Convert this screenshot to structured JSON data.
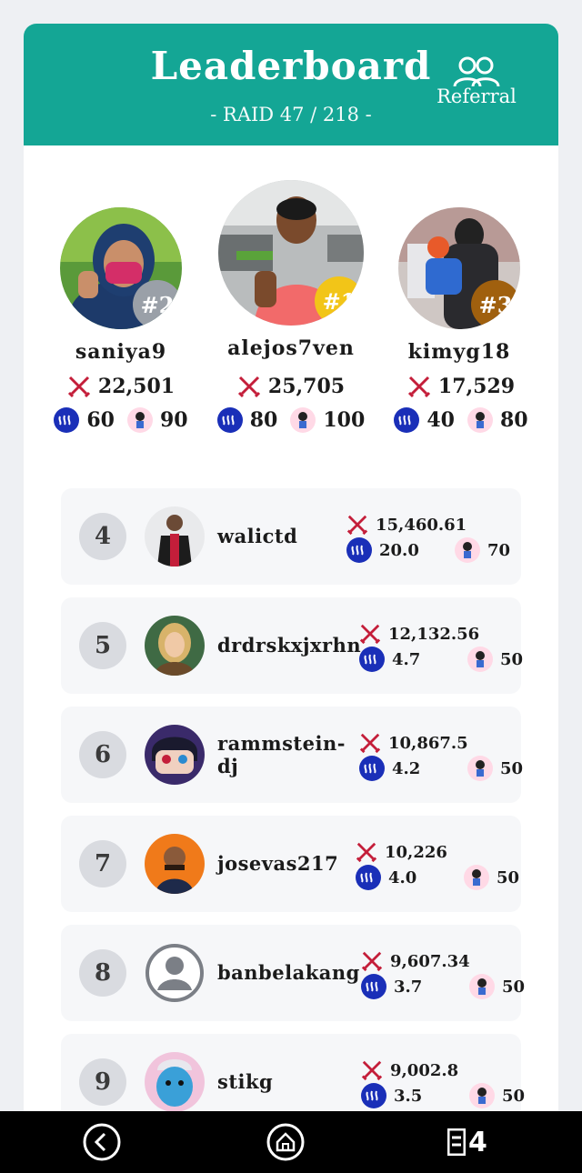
{
  "header": {
    "title": "Leaderboard",
    "subtitle": "- RAID 47 / 218 -",
    "referral_label": "Referral",
    "bg_color": "#14a695"
  },
  "podium": [
    {
      "place": "#2",
      "name": "saniya9",
      "score": "22,501",
      "steem": "60",
      "cards": "90",
      "badge_color": "#9aa0a8"
    },
    {
      "place": "#1",
      "name": "alejos7ven",
      "score": "25,705",
      "steem": "80",
      "cards": "100",
      "badge_color": "#f2c518"
    },
    {
      "place": "#3",
      "name": "kimyg18",
      "score": "17,529",
      "steem": "40",
      "cards": "80",
      "badge_color": "#a0600e"
    }
  ],
  "rows": [
    {
      "rank": "4",
      "name": "walictd",
      "score": "15,460.61",
      "steem": "20.0",
      "cards": "70"
    },
    {
      "rank": "5",
      "name": "drdrskxjxrhn",
      "score": "12,132.56",
      "steem": "4.7",
      "cards": "50"
    },
    {
      "rank": "6",
      "name": "rammstein-dj",
      "score": "10,867.5",
      "steem": "4.2",
      "cards": "50"
    },
    {
      "rank": "7",
      "name": "josevas217",
      "score": "10,226",
      "steem": "4.0",
      "cards": "50"
    },
    {
      "rank": "8",
      "name": "banbelakang",
      "score": "9,607.34",
      "steem": "3.7",
      "cards": "50"
    },
    {
      "rank": "9",
      "name": "stikg",
      "score": "9,002.8",
      "steem": "3.5",
      "cards": "50"
    }
  ],
  "icons": {
    "score": "crossed-swords-icon",
    "steem": "steem-icon",
    "cards": "character-card-icon",
    "referral": "users-icon",
    "back": "back-arrow-icon",
    "home": "home-icon",
    "tabs": "tab-switcher-icon"
  },
  "bottom_bar": {
    "tab_count": "4"
  }
}
